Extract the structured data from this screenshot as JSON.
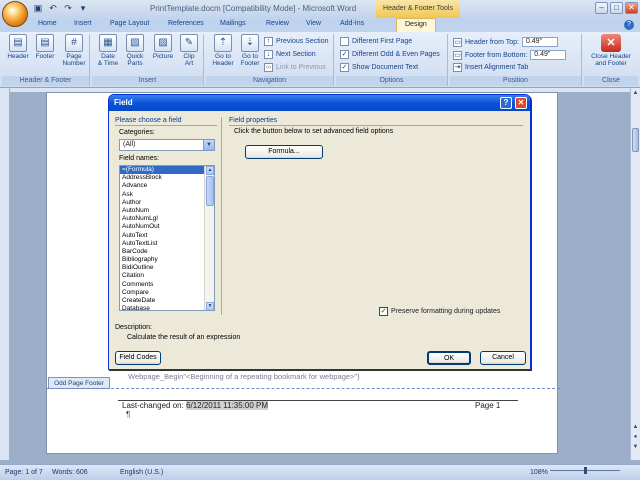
{
  "window": {
    "title": "PrintTemplate.docm [Compatibility Mode] - Microsoft Word",
    "contextual_tab_title": "Header & Footer Tools",
    "buttons": [
      "–",
      "□",
      "✕"
    ]
  },
  "tabs": [
    "Home",
    "Insert",
    "Page Layout",
    "References",
    "Mailings",
    "Review",
    "View",
    "Add-Ins",
    "Design"
  ],
  "ribbon": {
    "groups": {
      "header_footer": {
        "label": "Header & Footer",
        "header": "Header",
        "footer": "Footer",
        "page_number_1": "Page",
        "page_number_2": "Number"
      },
      "insert": {
        "label": "Insert",
        "date_time_1": "Date",
        "date_time_2": "& Time",
        "quick_parts_1": "Quick",
        "quick_parts_2": "Parts",
        "picture": "Picture",
        "clip_art_1": "Clip",
        "clip_art_2": "Art"
      },
      "navigation": {
        "label": "Navigation",
        "go_to_header_1": "Go to",
        "go_to_header_2": "Header",
        "go_to_footer_1": "Go to",
        "go_to_footer_2": "Footer",
        "previous_section": "Previous Section",
        "next_section": "Next Section",
        "link_to_previous": "Link to Previous"
      },
      "options": {
        "label": "Options",
        "different_first_page": "Different First Page",
        "different_odd_even": "Different Odd & Even Pages",
        "show_document_text": "Show Document Text"
      },
      "position": {
        "label": "Position",
        "header_from_top": "Header from Top:",
        "header_from_top_value": "0.49\"",
        "footer_from_bottom": "Footer from Bottom:",
        "footer_from_bottom_value": "0.49\"",
        "insert_alignment_tab": "Insert Alignment Tab"
      },
      "close": {
        "label": "Close",
        "close_header_footer_1": "Close Header",
        "close_header_footer_2": "and Footer"
      }
    }
  },
  "dialog": {
    "title": "Field",
    "please_choose": "Please choose a field",
    "categories_label": "Categories:",
    "categories_value": "(All)",
    "field_names_label": "Field names:",
    "field_names": [
      "=(Formula)",
      "AddressBlock",
      "Advance",
      "Ask",
      "Author",
      "AutoNum",
      "AutoNumLgl",
      "AutoNumOut",
      "AutoText",
      "AutoTextList",
      "BarCode",
      "Bibliography",
      "BidiOutline",
      "Citation",
      "Comments",
      "Compare",
      "CreateDate",
      "Database"
    ],
    "selected_index": 0,
    "field_properties": "Field properties",
    "advanced_hint": "Click the button below to set advanced field options",
    "formula_button": "Formula...",
    "preserve_formatting": "Preserve formatting during updates",
    "description_label": "Description:",
    "description_text": "Calculate the result of an expression",
    "field_codes_button": "Field Codes",
    "ok_button": "OK",
    "cancel_button": "Cancel"
  },
  "document": {
    "webpage_text": "Webpage_Begin\"<Beginning of a repeating bookmark for webpage>\"}",
    "footer_tag": "Odd Page Footer",
    "footer_last_changed": "Last-changed on:",
    "footer_date": "6/12/2011 11:35:00 PM",
    "footer_page": "Page 1",
    "pilcrow": "¶"
  },
  "status_bar": {
    "page": "Page: 1 of 7",
    "words": "Words: 606",
    "language": "English (U.S.)",
    "zoom": "108%"
  }
}
